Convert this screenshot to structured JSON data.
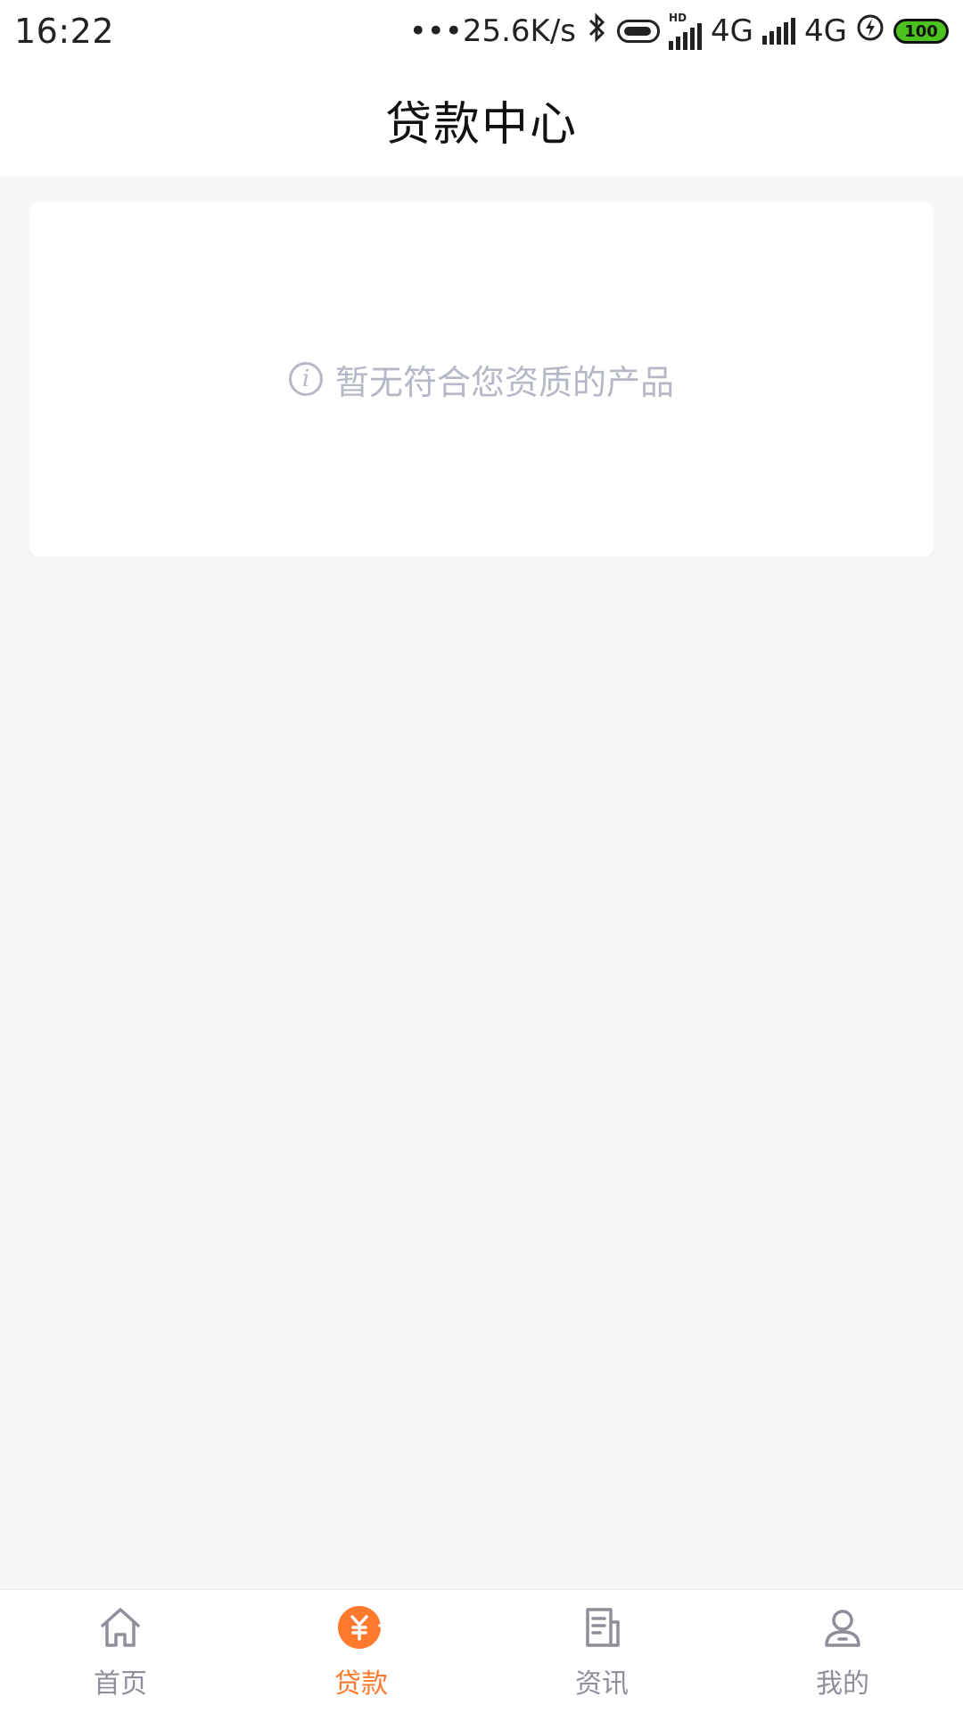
{
  "status_bar": {
    "time": "16:22",
    "network_speed": "•••25.6K/s",
    "sim1": "4G",
    "sim2": "4G",
    "battery": "100",
    "hd_label": "HD"
  },
  "header": {
    "title": "贷款中心"
  },
  "empty_state": {
    "message": "暂无符合您资质的产品",
    "icon": "info-icon"
  },
  "tabbar": {
    "items": [
      {
        "label": "首页",
        "icon": "home-icon",
        "active": false
      },
      {
        "label": "贷款",
        "icon": "yuan-loan-icon",
        "active": true
      },
      {
        "label": "资讯",
        "icon": "news-icon",
        "active": false
      },
      {
        "label": "我的",
        "icon": "profile-icon",
        "active": false
      }
    ]
  },
  "colors": {
    "accent": "#ff7a2d",
    "inactive": "#8e8f9a",
    "background": "#f5f6f8",
    "empty_text": "#b5b8c6"
  }
}
